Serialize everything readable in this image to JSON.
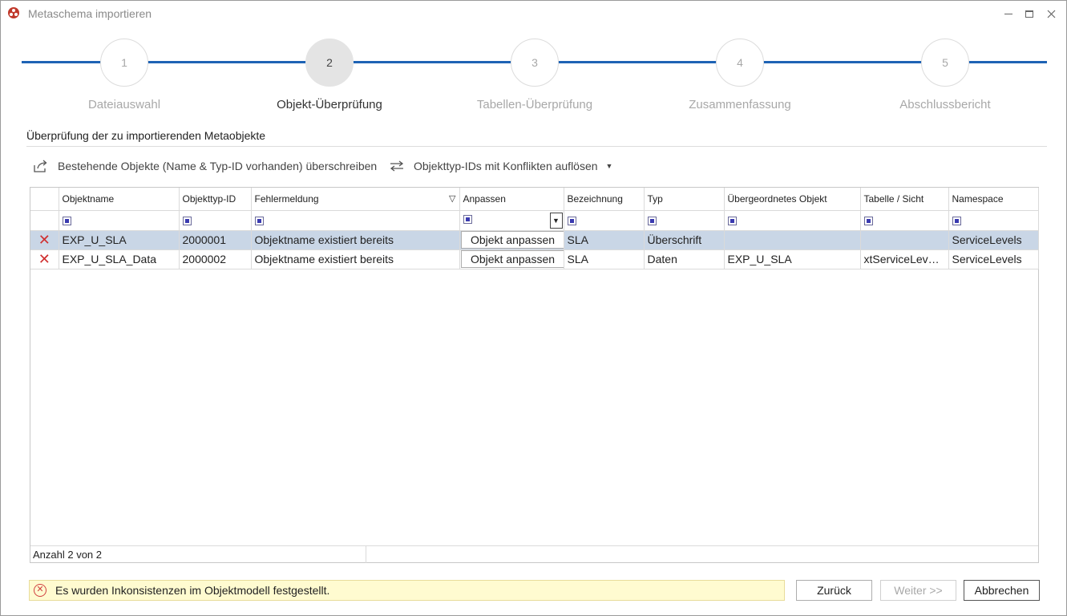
{
  "window": {
    "title": "Metaschema importieren"
  },
  "steps": [
    {
      "number": "1",
      "label": "Dateiauswahl",
      "active": false
    },
    {
      "number": "2",
      "label": "Objekt-Überprüfung",
      "active": true
    },
    {
      "number": "3",
      "label": "Tabellen-Überprüfung",
      "active": false
    },
    {
      "number": "4",
      "label": "Zusammenfassung",
      "active": false
    },
    {
      "number": "5",
      "label": "Abschlussbericht",
      "active": false
    }
  ],
  "section": {
    "title": "Überprüfung der zu importierenden Metaobjekte"
  },
  "toolbar": {
    "overwrite_label": "Bestehende Objekte (Name & Typ-ID vorhanden) überschreiben",
    "resolve_label": "Objekttyp-IDs mit Konflikten auflösen"
  },
  "grid": {
    "columns": [
      "Objektname",
      "Objekttyp-ID",
      "Fehlermeldung",
      "Anpassen",
      "Bezeichnung",
      "Typ",
      "Übergeordnetes Objekt",
      "Tabelle / Sicht",
      "Namespace"
    ],
    "rows": [
      {
        "name": "EXP_U_SLA",
        "type_id": "2000001",
        "error": "Objektname existiert bereits",
        "action": "Objekt anpassen",
        "label": "SLA",
        "type": "Überschrift",
        "parent": "",
        "table": "",
        "namespace": "ServiceLevels"
      },
      {
        "name": "EXP_U_SLA_Data",
        "type_id": "2000002",
        "error": "Objektname existiert bereits",
        "action": "Objekt anpassen",
        "label": "SLA",
        "type": "Daten",
        "parent": "EXP_U_SLA",
        "table": "xtServiceLevel…",
        "namespace": "ServiceLevels"
      }
    ],
    "footer_count": "Anzahl 2 von 2"
  },
  "status": {
    "message": "Es wurden Inkonsistenzen im Objektmodell festgestellt."
  },
  "buttons": {
    "back": "Zurück",
    "next": "Weiter >>",
    "cancel": "Abbrechen"
  },
  "colors": {
    "accent": "#1e63b4",
    "error": "#e02020",
    "selection": "#c9d6e6",
    "warning_bg": "#fffbd0"
  }
}
